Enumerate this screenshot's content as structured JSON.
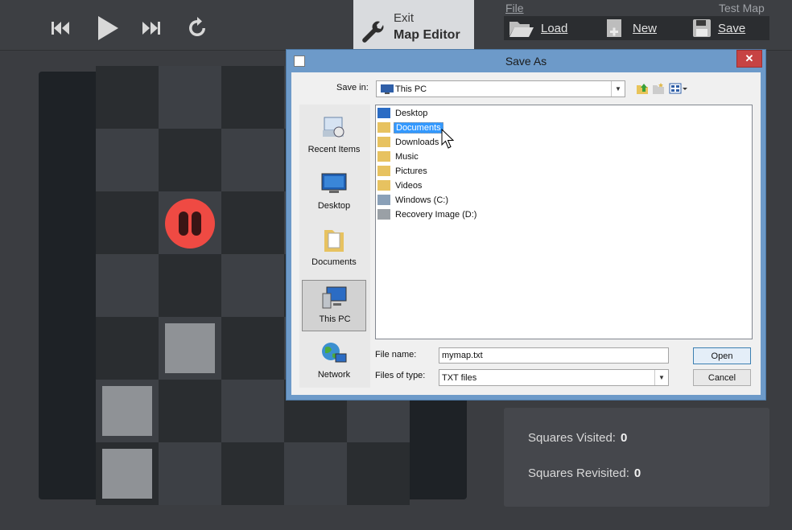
{
  "toolbar": {
    "icons": [
      "skip-back-icon",
      "play-icon",
      "skip-forward-icon",
      "restart-icon"
    ],
    "exit_small": "Exit",
    "exit_big": "Map Editor",
    "file_label": "File",
    "test_map_label": "Test Map",
    "load_label": "Load",
    "new_label": "New",
    "save_label": "Save"
  },
  "stats": {
    "visited_label": "Squares Visited:",
    "visited_value": "0",
    "revisited_label": "Squares Revisited:",
    "revisited_value": "0"
  },
  "dialog": {
    "title": "Save As",
    "close": "✕",
    "save_in_label": "Save in:",
    "save_in_value": "This PC",
    "places": [
      "Recent Items",
      "Desktop",
      "Documents",
      "This PC",
      "Network"
    ],
    "selected_place": "This PC",
    "files": [
      "Desktop",
      "Documents",
      "Downloads",
      "Music",
      "Pictures",
      "Videos",
      "Windows (C:)",
      "Recovery Image (D:)"
    ],
    "selected_file": "Documents",
    "file_name_label": "File name:",
    "file_name_value": "mymap.txt",
    "file_type_label": "Files of type:",
    "file_type_value": "TXT files",
    "open_label": "Open",
    "cancel_label": "Cancel"
  },
  "colors": {
    "accent": "#ef4a43",
    "dialog_frame": "#6d9ac9",
    "selection": "#3399ff",
    "close": "#c74343"
  }
}
